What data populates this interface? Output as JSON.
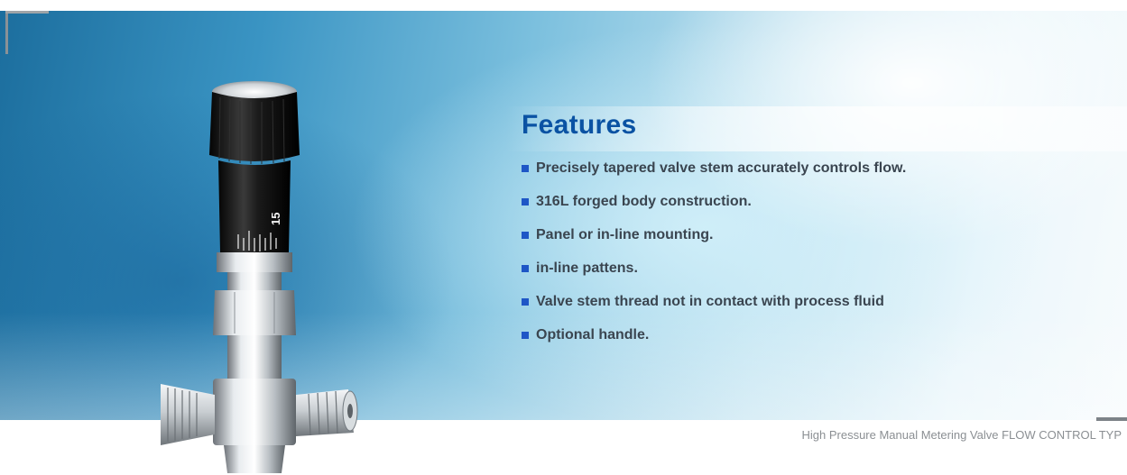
{
  "banner": {
    "title": "Features",
    "features": [
      "Precisely tapered valve stem accurately controls flow.",
      "316L forged body construction.",
      "Panel or in-line mounting.",
      "in-line pattens.",
      "Valve stem thread not in contact with process fluid",
      "Optional handle."
    ],
    "caption": "High Pressure Manual Metering Valve FLOW CONTROL TYP",
    "knob_scale_label": "15"
  },
  "colors": {
    "title": "#0a52a3",
    "bullet": "#1e56c6",
    "text": "#3a4550",
    "caption": "#8b8f93"
  },
  "icons": {
    "bullet": "blue-square-bullet",
    "product": "metering-valve-image"
  }
}
